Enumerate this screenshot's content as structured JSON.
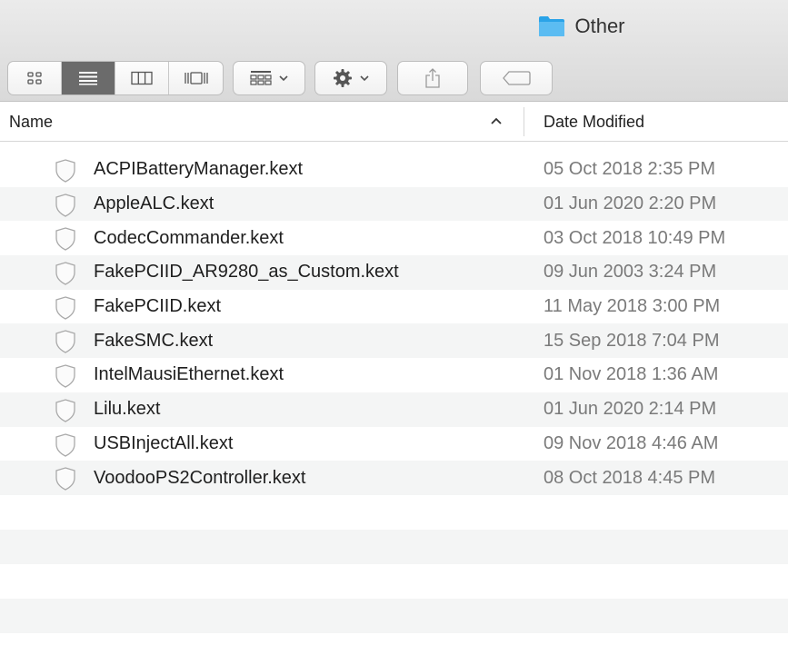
{
  "window": {
    "title": "Other"
  },
  "toolbar": {
    "view_buttons": [
      {
        "name": "icon-view",
        "icon": "icon-grid-icon",
        "active": false
      },
      {
        "name": "list-view",
        "icon": "list-lines-icon",
        "active": true
      },
      {
        "name": "column-view",
        "icon": "columns-icon",
        "active": false
      },
      {
        "name": "cover-flow-view",
        "icon": "cover-flow-icon",
        "active": false
      }
    ],
    "arrange_icon": "arrange-grid-icon",
    "action_icon": "gear-icon",
    "share_icon": "share-icon",
    "tag_icon": "tag-icon"
  },
  "columns": {
    "name": "Name",
    "date_modified": "Date Modified",
    "sort_indicator": "ascending"
  },
  "files": [
    {
      "name": "ACPIBatteryManager.kext",
      "date": "05 Oct 2018 2:35 PM"
    },
    {
      "name": "AppleALC.kext",
      "date": "01 Jun 2020 2:20 PM"
    },
    {
      "name": "CodecCommander.kext",
      "date": "03 Oct 2018 10:49 PM"
    },
    {
      "name": "FakePCIID_AR9280_as_Custom.kext",
      "date": "09 Jun 2003 3:24 PM"
    },
    {
      "name": "FakePCIID.kext",
      "date": "11 May 2018 3:00 PM"
    },
    {
      "name": "FakeSMC.kext",
      "date": "15 Sep 2018 7:04 PM"
    },
    {
      "name": "IntelMausiEthernet.kext",
      "date": "01 Nov 2018 1:36 AM"
    },
    {
      "name": "Lilu.kext",
      "date": "01 Jun 2020 2:14 PM"
    },
    {
      "name": "USBInjectAll.kext",
      "date": "09 Nov 2018 4:46 AM"
    },
    {
      "name": "VoodooPS2Controller.kext",
      "date": "08 Oct 2018 4:45 PM"
    }
  ],
  "colors": {
    "folder_blue": "#2aa3e8",
    "toolbar_bg": "#e2e2e2",
    "active_segment": "#6b6b6b",
    "stripe": "#f4f5f5",
    "date_text": "#7a7a7a"
  }
}
